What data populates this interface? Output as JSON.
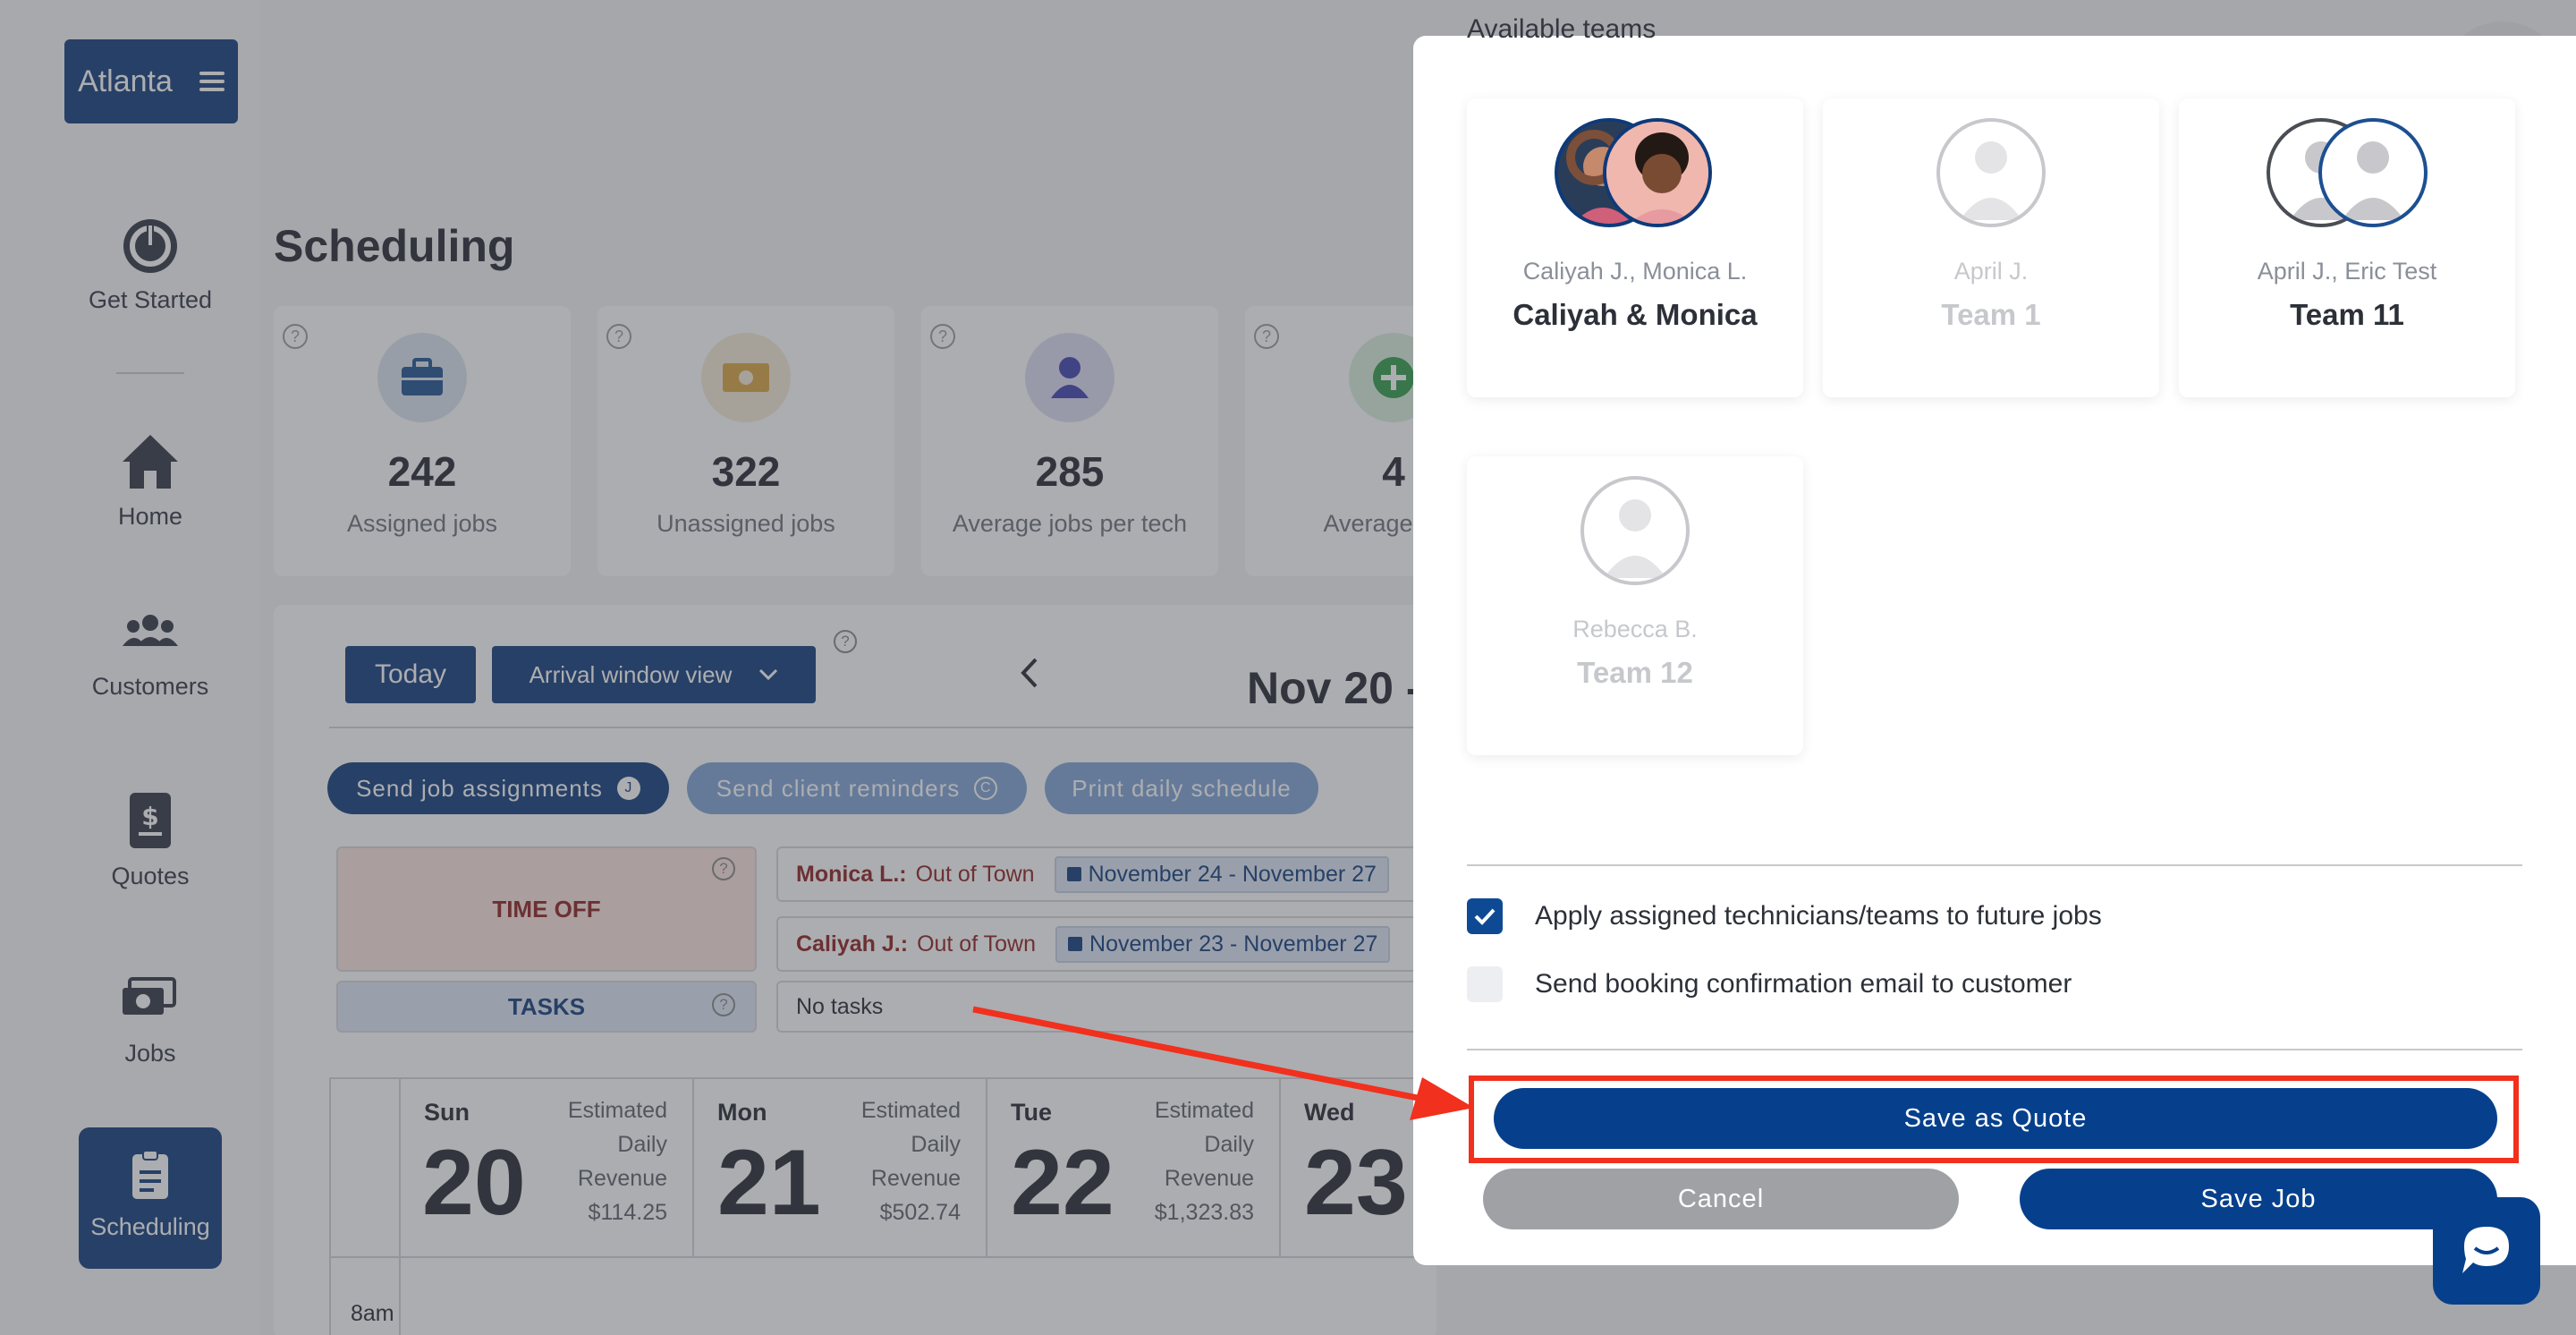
{
  "sidebar": {
    "brand": "Atlanta",
    "items": [
      {
        "label": "Get Started",
        "icon": "power-icon"
      },
      {
        "label": "Home",
        "icon": "home-icon"
      },
      {
        "label": "Customers",
        "icon": "users-icon"
      },
      {
        "label": "Quotes",
        "icon": "quote-icon"
      },
      {
        "label": "Jobs",
        "icon": "jobs-icon"
      },
      {
        "label": "Scheduling",
        "icon": "clipboard-icon",
        "active": true
      }
    ]
  },
  "main": {
    "title": "Scheduling",
    "stats": [
      {
        "value": "242",
        "label": "Assigned jobs",
        "icon": "briefcase-icon",
        "color": "#1d4f91"
      },
      {
        "value": "322",
        "label": "Unassigned jobs",
        "icon": "money-icon",
        "color": "#d9a441"
      },
      {
        "value": "285",
        "label": "Average jobs per tech",
        "icon": "person-icon",
        "color": "#3b3fb0"
      },
      {
        "value": "4",
        "label": "Average jobs",
        "icon": "plus-icon",
        "color": "#2f9b47"
      }
    ],
    "toolbar": {
      "today": "Today",
      "view": "Arrival window view",
      "week": "Nov 20 -"
    },
    "actions": {
      "send_assignments": "Send job assignments",
      "send_assignments_badge": "J",
      "send_reminders": "Send client reminders",
      "send_reminders_badge": "C",
      "print_schedule": "Print daily schedule"
    },
    "time_off": {
      "label": "TIME OFF",
      "entries": [
        {
          "who": "Monica L.:",
          "why": "Out of Town",
          "dates": "November 24 - November 27"
        },
        {
          "who": "Caliyah J.:",
          "why": "Out of Town",
          "dates": "November 23 - November 27"
        }
      ]
    },
    "tasks": {
      "label": "TASKS",
      "value": "No tasks"
    },
    "days": [
      {
        "name": "Sun",
        "num": "20",
        "rev_label": [
          "Estimated",
          "Daily",
          "Revenue"
        ],
        "rev": "$114.25"
      },
      {
        "name": "Mon",
        "num": "21",
        "rev_label": [
          "Estimated",
          "Daily",
          "Revenue"
        ],
        "rev": "$502.74"
      },
      {
        "name": "Tue",
        "num": "22",
        "rev_label": [
          "Estimated",
          "Daily",
          "Revenue"
        ],
        "rev": "$1,323.83"
      },
      {
        "name": "Wed",
        "num": "23"
      }
    ],
    "time_label": "8am"
  },
  "modal": {
    "section_label": "Available teams",
    "teams": [
      {
        "members": "Caliyah J., Monica L.",
        "name": "Caliyah & Monica",
        "state": "enabled"
      },
      {
        "members": "April J.",
        "name": "Team 1",
        "state": "disabled"
      },
      {
        "members": "April J., Eric Test",
        "name": "Team 11",
        "state": "enabled"
      },
      {
        "members": "Rebecca B.",
        "name": "Team 12",
        "state": "disabled"
      }
    ],
    "apply_future": "Apply assigned technicians/teams to future jobs",
    "apply_future_checked": true,
    "send_confirmation": "Send booking confirmation email to customer",
    "send_confirmation_checked": false,
    "save_quote": "Save as Quote",
    "cancel": "Cancel",
    "save_job": "Save Job"
  },
  "colors": {
    "brand": "#0e3a7a",
    "primary_button": "#06408c",
    "highlight": "#f1301d"
  }
}
